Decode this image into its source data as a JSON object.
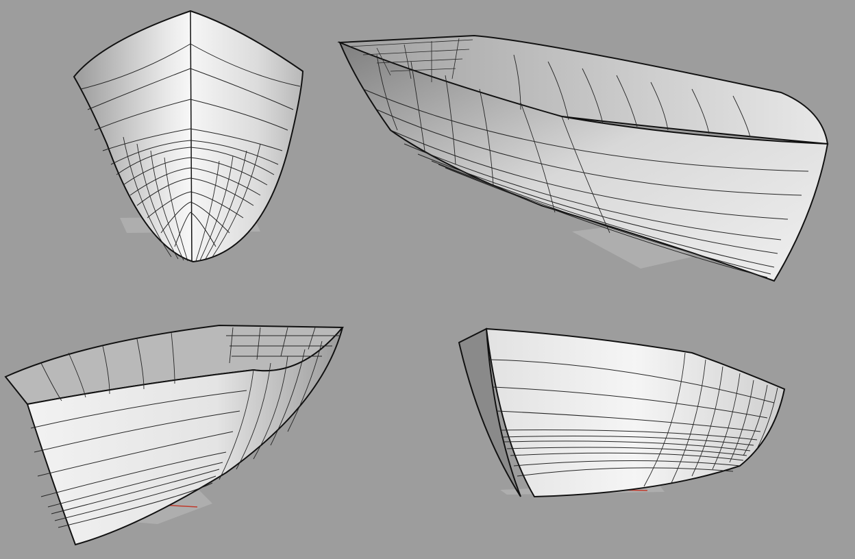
{
  "scene": {
    "background": "#9d9d9d",
    "views": [
      {
        "id": "bow-front-view"
      },
      {
        "id": "perspective-bow-high"
      },
      {
        "id": "perspective-bow-low"
      },
      {
        "id": "perspective-stern"
      }
    ]
  },
  "colors": {
    "hull_light": "#f1f1f1",
    "hull_mid": "#d2d2d2",
    "hull_dark": "#8a8a8a",
    "edge": "#111111",
    "grid": "#b7b7b7",
    "grid_line": "#a9a9a9",
    "x_axis": "#c0392b"
  }
}
